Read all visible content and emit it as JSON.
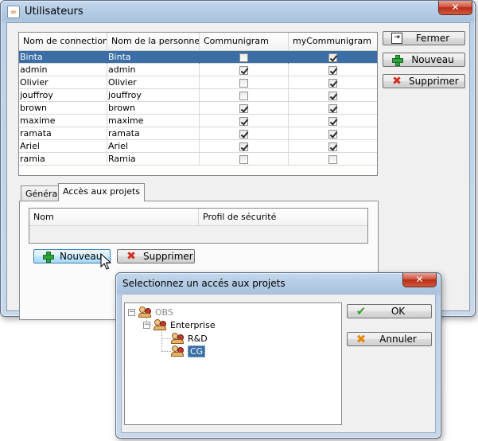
{
  "main_window": {
    "title": "Utilisateurs",
    "close_glyph": "✕",
    "buttons": {
      "close": "Fermer",
      "new": "Nouveau",
      "delete": "Supprimer"
    },
    "table": {
      "columns": [
        "Nom de connection",
        "Nom de la personne",
        "Communigram",
        "myCommunigram"
      ],
      "rows": [
        {
          "login": "Binta",
          "name": "Binta",
          "communigram": false,
          "mycommunigram": true,
          "selected": true
        },
        {
          "login": "admin",
          "name": "admin",
          "communigram": true,
          "mycommunigram": true
        },
        {
          "login": "Olivier",
          "name": "Olivier",
          "communigram": false,
          "mycommunigram": true
        },
        {
          "login": "jouffroy",
          "name": "jouffroy",
          "communigram": false,
          "mycommunigram": true
        },
        {
          "login": "brown",
          "name": "brown",
          "communigram": true,
          "mycommunigram": true
        },
        {
          "login": "maxime",
          "name": "maxime",
          "communigram": true,
          "mycommunigram": true
        },
        {
          "login": "ramata",
          "name": "ramata",
          "communigram": true,
          "mycommunigram": true
        },
        {
          "login": "Ariel",
          "name": "Ariel",
          "communigram": true,
          "mycommunigram": true
        },
        {
          "login": "ramia",
          "name": "Ramia",
          "communigram": false,
          "mycommunigram": false
        }
      ]
    },
    "tabs": [
      {
        "label": "Général"
      },
      {
        "label": "Accès aux projets",
        "active": true
      }
    ],
    "projects_panel": {
      "columns": [
        "Nom",
        "Profil de sécurité"
      ],
      "buttons": {
        "new": "Nouveau",
        "delete": "Supprimer"
      }
    }
  },
  "dialog": {
    "title": "Selectionnez un accés aux projets",
    "close_glyph": "✕",
    "tree": {
      "root": "OBS",
      "child": "Enterprise",
      "leaves": [
        {
          "label": "R&D"
        },
        {
          "label": "CG",
          "selected": true
        }
      ]
    },
    "buttons": {
      "ok": "OK",
      "cancel": "Annuler"
    }
  },
  "icons": {
    "app": "java-cup-icon",
    "close": "door-exit-icon",
    "add": "plus-icon",
    "delete": "red-x-icon",
    "ok": "green-check-icon",
    "cancel": "orange-x-icon",
    "tree_node": "people-group-icon"
  },
  "colors": {
    "selection": "#3a6ea5",
    "close_button": "#c8402a",
    "title_bar": "#b9cfe7"
  }
}
